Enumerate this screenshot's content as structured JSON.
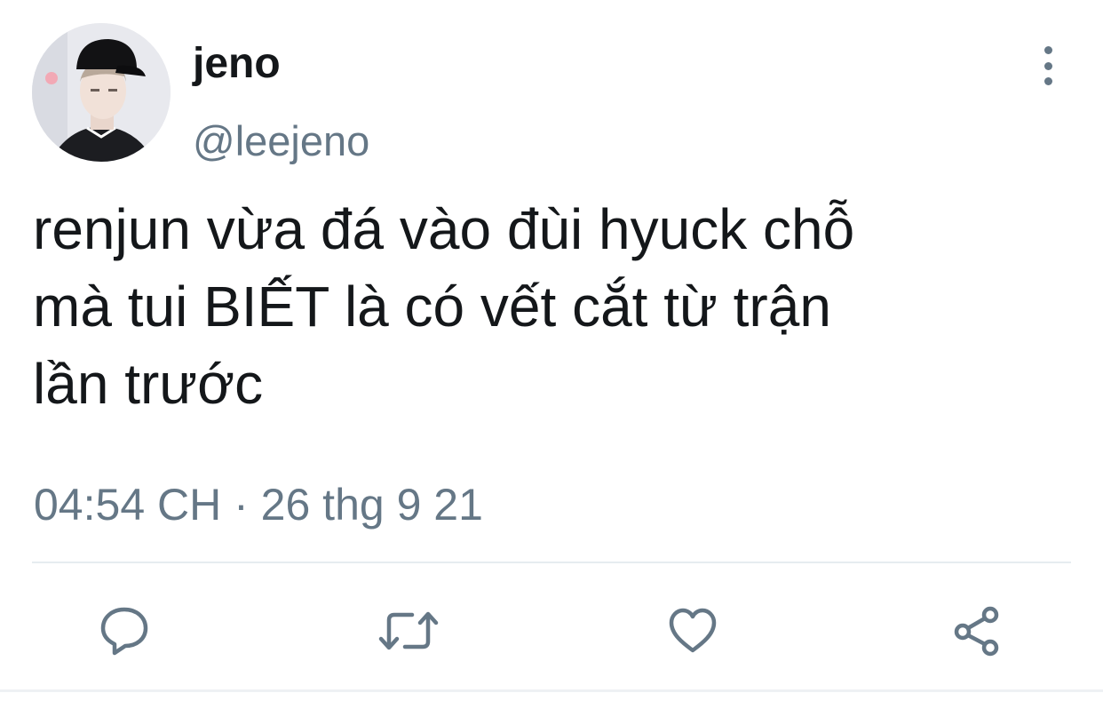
{
  "tweet": {
    "author": {
      "display_name": "jeno",
      "handle": "@leejeno"
    },
    "text": "renjun vừa đá vào đùi hyuck chỗ\nmà tui BIẾT là có vết cắt từ trận\nlần trước",
    "timestamp": "04:54 CH · 26 thg 9 21"
  },
  "icons": {
    "more": "more-vertical-icon",
    "reply": "reply-icon",
    "retweet": "retweet-icon",
    "like": "heart-icon",
    "share": "share-icon"
  },
  "colors": {
    "text_primary": "#14171a",
    "text_secondary": "#657786",
    "divider": "#e6ecf0"
  }
}
